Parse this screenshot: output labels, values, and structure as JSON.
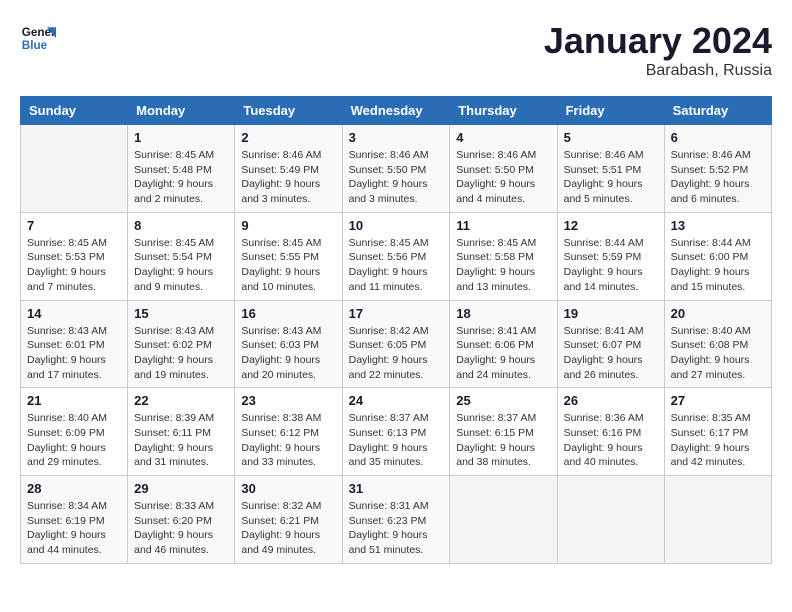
{
  "header": {
    "logo_general": "General",
    "logo_blue": "Blue",
    "month_title": "January 2024",
    "subtitle": "Barabash, Russia"
  },
  "days_of_week": [
    "Sunday",
    "Monday",
    "Tuesday",
    "Wednesday",
    "Thursday",
    "Friday",
    "Saturday"
  ],
  "weeks": [
    [
      {
        "day": "",
        "sunrise": "",
        "sunset": "",
        "daylight": ""
      },
      {
        "day": "1",
        "sunrise": "Sunrise: 8:45 AM",
        "sunset": "Sunset: 5:48 PM",
        "daylight": "Daylight: 9 hours and 2 minutes."
      },
      {
        "day": "2",
        "sunrise": "Sunrise: 8:46 AM",
        "sunset": "Sunset: 5:49 PM",
        "daylight": "Daylight: 9 hours and 3 minutes."
      },
      {
        "day": "3",
        "sunrise": "Sunrise: 8:46 AM",
        "sunset": "Sunset: 5:50 PM",
        "daylight": "Daylight: 9 hours and 3 minutes."
      },
      {
        "day": "4",
        "sunrise": "Sunrise: 8:46 AM",
        "sunset": "Sunset: 5:50 PM",
        "daylight": "Daylight: 9 hours and 4 minutes."
      },
      {
        "day": "5",
        "sunrise": "Sunrise: 8:46 AM",
        "sunset": "Sunset: 5:51 PM",
        "daylight": "Daylight: 9 hours and 5 minutes."
      },
      {
        "day": "6",
        "sunrise": "Sunrise: 8:46 AM",
        "sunset": "Sunset: 5:52 PM",
        "daylight": "Daylight: 9 hours and 6 minutes."
      }
    ],
    [
      {
        "day": "7",
        "sunrise": "Sunrise: 8:45 AM",
        "sunset": "Sunset: 5:53 PM",
        "daylight": "Daylight: 9 hours and 7 minutes."
      },
      {
        "day": "8",
        "sunrise": "Sunrise: 8:45 AM",
        "sunset": "Sunset: 5:54 PM",
        "daylight": "Daylight: 9 hours and 9 minutes."
      },
      {
        "day": "9",
        "sunrise": "Sunrise: 8:45 AM",
        "sunset": "Sunset: 5:55 PM",
        "daylight": "Daylight: 9 hours and 10 minutes."
      },
      {
        "day": "10",
        "sunrise": "Sunrise: 8:45 AM",
        "sunset": "Sunset: 5:56 PM",
        "daylight": "Daylight: 9 hours and 11 minutes."
      },
      {
        "day": "11",
        "sunrise": "Sunrise: 8:45 AM",
        "sunset": "Sunset: 5:58 PM",
        "daylight": "Daylight: 9 hours and 13 minutes."
      },
      {
        "day": "12",
        "sunrise": "Sunrise: 8:44 AM",
        "sunset": "Sunset: 5:59 PM",
        "daylight": "Daylight: 9 hours and 14 minutes."
      },
      {
        "day": "13",
        "sunrise": "Sunrise: 8:44 AM",
        "sunset": "Sunset: 6:00 PM",
        "daylight": "Daylight: 9 hours and 15 minutes."
      }
    ],
    [
      {
        "day": "14",
        "sunrise": "Sunrise: 8:43 AM",
        "sunset": "Sunset: 6:01 PM",
        "daylight": "Daylight: 9 hours and 17 minutes."
      },
      {
        "day": "15",
        "sunrise": "Sunrise: 8:43 AM",
        "sunset": "Sunset: 6:02 PM",
        "daylight": "Daylight: 9 hours and 19 minutes."
      },
      {
        "day": "16",
        "sunrise": "Sunrise: 8:43 AM",
        "sunset": "Sunset: 6:03 PM",
        "daylight": "Daylight: 9 hours and 20 minutes."
      },
      {
        "day": "17",
        "sunrise": "Sunrise: 8:42 AM",
        "sunset": "Sunset: 6:05 PM",
        "daylight": "Daylight: 9 hours and 22 minutes."
      },
      {
        "day": "18",
        "sunrise": "Sunrise: 8:41 AM",
        "sunset": "Sunset: 6:06 PM",
        "daylight": "Daylight: 9 hours and 24 minutes."
      },
      {
        "day": "19",
        "sunrise": "Sunrise: 8:41 AM",
        "sunset": "Sunset: 6:07 PM",
        "daylight": "Daylight: 9 hours and 26 minutes."
      },
      {
        "day": "20",
        "sunrise": "Sunrise: 8:40 AM",
        "sunset": "Sunset: 6:08 PM",
        "daylight": "Daylight: 9 hours and 27 minutes."
      }
    ],
    [
      {
        "day": "21",
        "sunrise": "Sunrise: 8:40 AM",
        "sunset": "Sunset: 6:09 PM",
        "daylight": "Daylight: 9 hours and 29 minutes."
      },
      {
        "day": "22",
        "sunrise": "Sunrise: 8:39 AM",
        "sunset": "Sunset: 6:11 PM",
        "daylight": "Daylight: 9 hours and 31 minutes."
      },
      {
        "day": "23",
        "sunrise": "Sunrise: 8:38 AM",
        "sunset": "Sunset: 6:12 PM",
        "daylight": "Daylight: 9 hours and 33 minutes."
      },
      {
        "day": "24",
        "sunrise": "Sunrise: 8:37 AM",
        "sunset": "Sunset: 6:13 PM",
        "daylight": "Daylight: 9 hours and 35 minutes."
      },
      {
        "day": "25",
        "sunrise": "Sunrise: 8:37 AM",
        "sunset": "Sunset: 6:15 PM",
        "daylight": "Daylight: 9 hours and 38 minutes."
      },
      {
        "day": "26",
        "sunrise": "Sunrise: 8:36 AM",
        "sunset": "Sunset: 6:16 PM",
        "daylight": "Daylight: 9 hours and 40 minutes."
      },
      {
        "day": "27",
        "sunrise": "Sunrise: 8:35 AM",
        "sunset": "Sunset: 6:17 PM",
        "daylight": "Daylight: 9 hours and 42 minutes."
      }
    ],
    [
      {
        "day": "28",
        "sunrise": "Sunrise: 8:34 AM",
        "sunset": "Sunset: 6:19 PM",
        "daylight": "Daylight: 9 hours and 44 minutes."
      },
      {
        "day": "29",
        "sunrise": "Sunrise: 8:33 AM",
        "sunset": "Sunset: 6:20 PM",
        "daylight": "Daylight: 9 hours and 46 minutes."
      },
      {
        "day": "30",
        "sunrise": "Sunrise: 8:32 AM",
        "sunset": "Sunset: 6:21 PM",
        "daylight": "Daylight: 9 hours and 49 minutes."
      },
      {
        "day": "31",
        "sunrise": "Sunrise: 8:31 AM",
        "sunset": "Sunset: 6:23 PM",
        "daylight": "Daylight: 9 hours and 51 minutes."
      },
      {
        "day": "",
        "sunrise": "",
        "sunset": "",
        "daylight": ""
      },
      {
        "day": "",
        "sunrise": "",
        "sunset": "",
        "daylight": ""
      },
      {
        "day": "",
        "sunrise": "",
        "sunset": "",
        "daylight": ""
      }
    ]
  ]
}
